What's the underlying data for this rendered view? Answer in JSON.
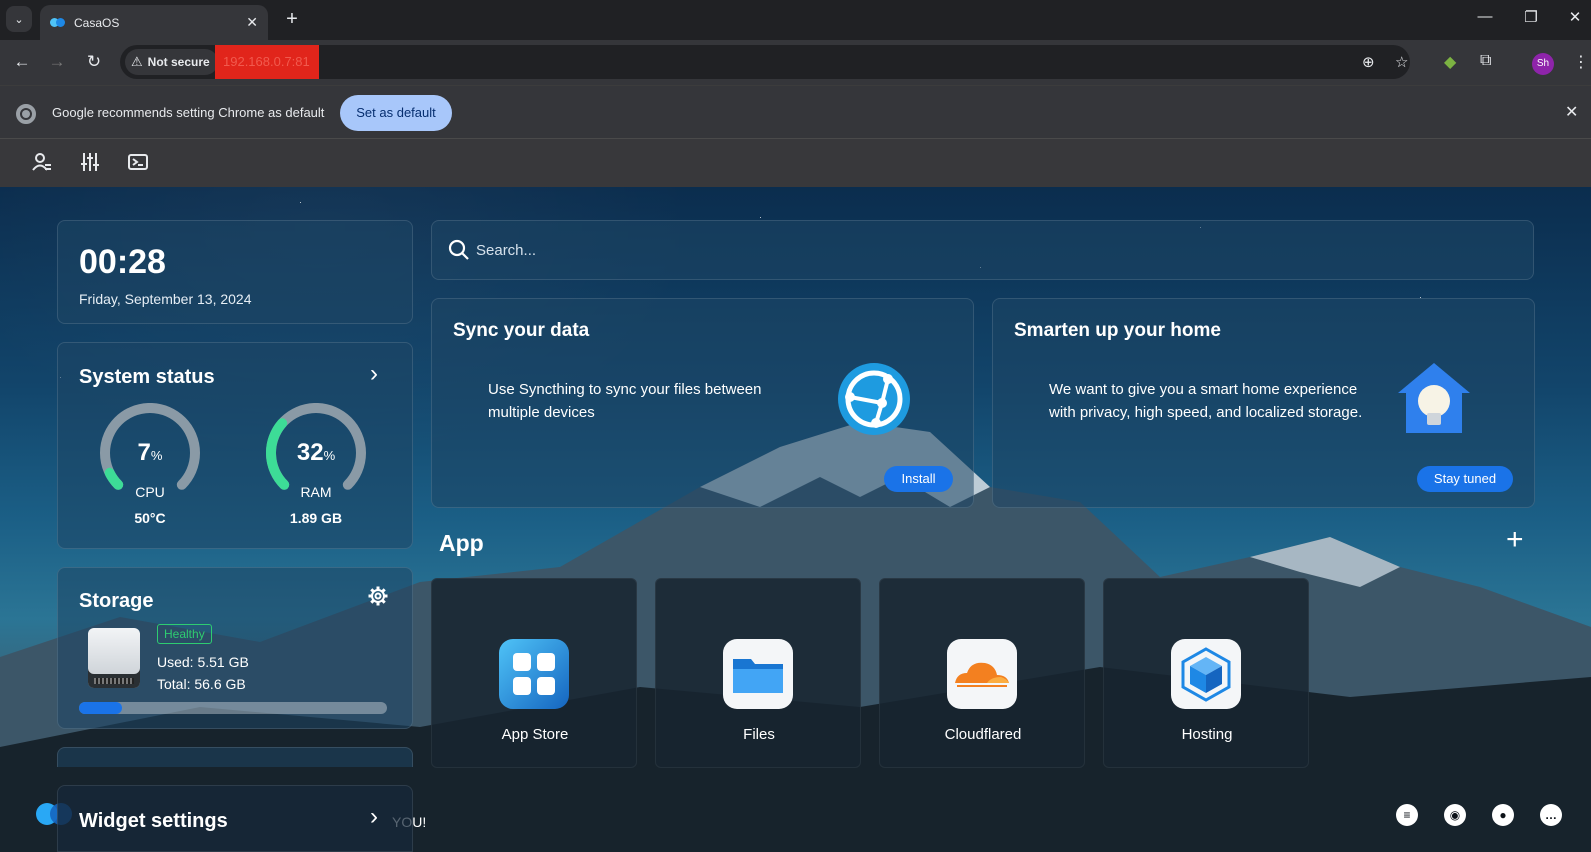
{
  "browser": {
    "tab_title": "CasaOS",
    "tab_close": "✕",
    "new_tab": "+",
    "tab_menu": "⌄",
    "not_secure": "Not secure",
    "url_redacted": "192.168.0.7:81",
    "profile_initials": "Sh",
    "window": {
      "minimize": "—",
      "restore": "❐",
      "close": "✕"
    }
  },
  "infobar": {
    "message": "Google recommends setting Chrome as default",
    "button": "Set as default",
    "close": "✕"
  },
  "clock": {
    "time": "00:28",
    "date": "Friday, September 13, 2024"
  },
  "system_status": {
    "title": "System status",
    "cpu": {
      "value": "7",
      "unit": "%",
      "label": "CPU",
      "sub": "50°C",
      "fraction": 0.07
    },
    "ram": {
      "value": "32",
      "unit": "%",
      "label": "RAM",
      "sub": "1.89 GB",
      "fraction": 0.32
    }
  },
  "storage": {
    "title": "Storage",
    "status": "Healthy",
    "used": "Used: 5.51 GB",
    "total": "Total: 56.6 GB",
    "used_fraction": 0.14
  },
  "widget_settings": {
    "title": "Widget settings"
  },
  "search": {
    "placeholder": "Search..."
  },
  "cards": [
    {
      "title": "Sync your data",
      "desc": "Use Syncthing to sync your files between multiple devices",
      "button": "Install"
    },
    {
      "title": "Smarten up your home",
      "desc": "We want to give you a smart home experience with privacy, high speed, and localized storage.",
      "button": "Stay tuned"
    }
  ],
  "apps": {
    "title": "App",
    "add": "+",
    "items": [
      {
        "label": "App Store",
        "icon": "app-store-icon"
      },
      {
        "label": "Files",
        "icon": "folder-icon"
      },
      {
        "label": "Cloudflared",
        "icon": "cloudflare-icon"
      },
      {
        "label": "Hosting",
        "icon": "cube-icon"
      }
    ]
  },
  "footer": {
    "text": "YOU!"
  },
  "colors": {
    "accent": "#1a73e8",
    "healthy": "#2ecc71",
    "gauge": "#3ddc97"
  }
}
